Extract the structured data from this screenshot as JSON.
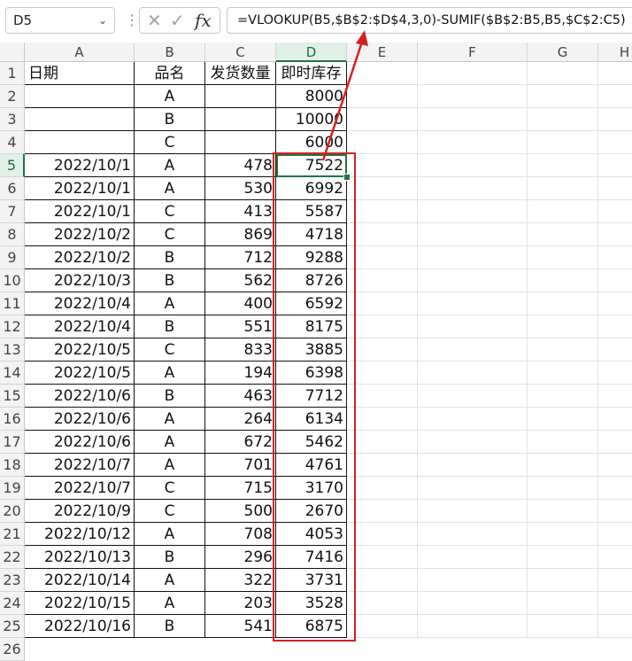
{
  "namebox": {
    "value": "D5"
  },
  "formula_bar": {
    "formula": "=VLOOKUP(B5,$B$2:$D$4,3,0)-SUMIF($B$2:B5,B5,$C$2:C5)",
    "fx_label": "fx"
  },
  "columns": [
    "A",
    "B",
    "C",
    "D",
    "E",
    "F",
    "G",
    "H"
  ],
  "header_row": {
    "a": "日期",
    "b": "品名",
    "c": "发货数量",
    "d": "即时库存"
  },
  "rows": [
    {
      "n": "2",
      "a": "",
      "b": "A",
      "c": "",
      "d": "8000"
    },
    {
      "n": "3",
      "a": "",
      "b": "B",
      "c": "",
      "d": "10000"
    },
    {
      "n": "4",
      "a": "",
      "b": "C",
      "c": "",
      "d": "6000"
    },
    {
      "n": "5",
      "a": "2022/10/1",
      "b": "A",
      "c": "478",
      "d": "7522"
    },
    {
      "n": "6",
      "a": "2022/10/1",
      "b": "A",
      "c": "530",
      "d": "6992"
    },
    {
      "n": "7",
      "a": "2022/10/1",
      "b": "C",
      "c": "413",
      "d": "5587"
    },
    {
      "n": "8",
      "a": "2022/10/2",
      "b": "C",
      "c": "869",
      "d": "4718"
    },
    {
      "n": "9",
      "a": "2022/10/2",
      "b": "B",
      "c": "712",
      "d": "9288"
    },
    {
      "n": "10",
      "a": "2022/10/3",
      "b": "B",
      "c": "562",
      "d": "8726"
    },
    {
      "n": "11",
      "a": "2022/10/4",
      "b": "A",
      "c": "400",
      "d": "6592"
    },
    {
      "n": "12",
      "a": "2022/10/4",
      "b": "B",
      "c": "551",
      "d": "8175"
    },
    {
      "n": "13",
      "a": "2022/10/5",
      "b": "C",
      "c": "833",
      "d": "3885"
    },
    {
      "n": "14",
      "a": "2022/10/5",
      "b": "A",
      "c": "194",
      "d": "6398"
    },
    {
      "n": "15",
      "a": "2022/10/6",
      "b": "B",
      "c": "463",
      "d": "7712"
    },
    {
      "n": "16",
      "a": "2022/10/6",
      "b": "A",
      "c": "264",
      "d": "6134"
    },
    {
      "n": "17",
      "a": "2022/10/6",
      "b": "A",
      "c": "672",
      "d": "5462"
    },
    {
      "n": "18",
      "a": "2022/10/7",
      "b": "A",
      "c": "701",
      "d": "4761"
    },
    {
      "n": "19",
      "a": "2022/10/7",
      "b": "C",
      "c": "715",
      "d": "3170"
    },
    {
      "n": "20",
      "a": "2022/10/9",
      "b": "C",
      "c": "500",
      "d": "2670"
    },
    {
      "n": "21",
      "a": "2022/10/12",
      "b": "A",
      "c": "708",
      "d": "4053"
    },
    {
      "n": "22",
      "a": "2022/10/13",
      "b": "B",
      "c": "296",
      "d": "7416"
    },
    {
      "n": "23",
      "a": "2022/10/14",
      "b": "A",
      "c": "322",
      "d": "3731"
    },
    {
      "n": "24",
      "a": "2022/10/15",
      "b": "A",
      "c": "203",
      "d": "3528"
    },
    {
      "n": "25",
      "a": "2022/10/16",
      "b": "B",
      "c": "541",
      "d": "6875"
    }
  ],
  "trailing_row_label": "26",
  "colors": {
    "accent": "#217346",
    "annotation": "#d42020"
  }
}
